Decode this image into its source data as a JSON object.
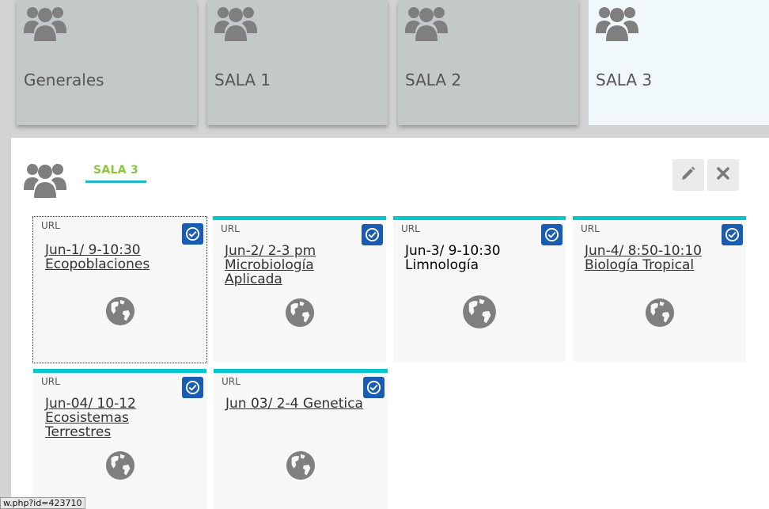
{
  "groups": [
    {
      "label": "Generales"
    },
    {
      "label": "SALA 1"
    },
    {
      "label": "SALA 2"
    },
    {
      "label": "SALA 3"
    }
  ],
  "panel": {
    "title": "SALA 3"
  },
  "cards": [
    {
      "type": "URL",
      "title": "Jun-1/ 9-10:30 Ecopoblaciones"
    },
    {
      "type": "URL",
      "title": "Jun-2/ 2-3 pm Microbiología Aplicada"
    },
    {
      "type": "URL",
      "title": "Jun-3/ 9-10:30 Limnología"
    },
    {
      "type": "URL",
      "title": "Jun-4/ 8:50-10:10 Biología Tropical"
    },
    {
      "type": "URL",
      "title": "Jun-04/ 10-12 Ecosistemas Terrestres"
    },
    {
      "type": "URL",
      "title": "Jun 03/ 2-4 Genetica"
    }
  ],
  "status_tip": "w.php?id=423710",
  "colors": {
    "accent_teal": "#00c7cc",
    "title_green": "#8cc63f",
    "check_blue": "#1a5db0",
    "tile_gray": "#c3c9c9"
  }
}
